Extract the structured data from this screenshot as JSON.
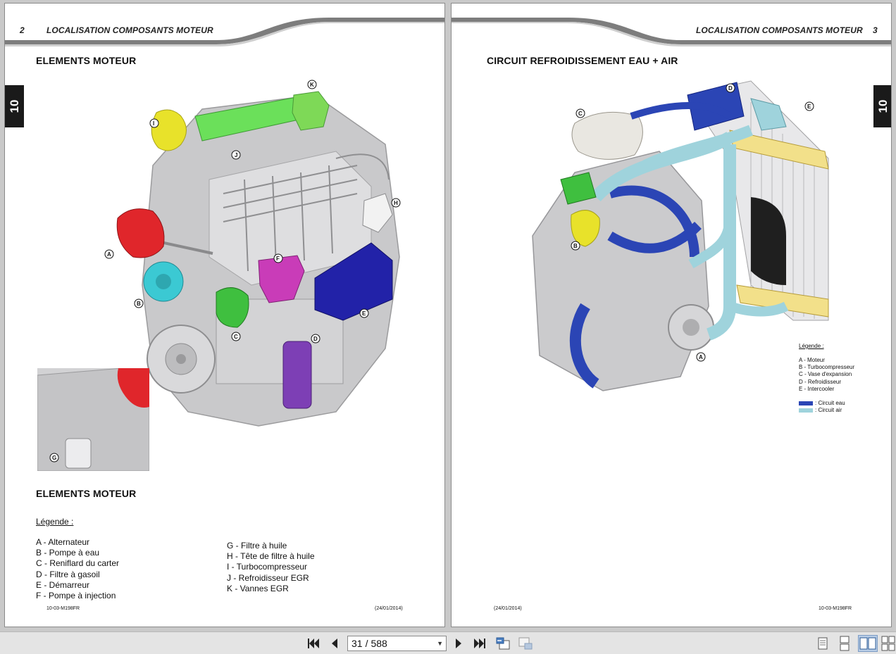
{
  "left_page": {
    "page_number": "2",
    "header_title": "LOCALISATION COMPOSANTS MOTEUR",
    "tab_label": "10",
    "section_title": "ELEMENTS MOTEUR",
    "section_title_2": "ELEMENTS MOTEUR",
    "figure_callouts": [
      "A",
      "B",
      "C",
      "D",
      "E",
      "F",
      "H",
      "I",
      "J",
      "K"
    ],
    "inset_callout": "G",
    "legend_title": "Légende :",
    "legend_col1": [
      "A - Alternateur",
      "B - Pompe à eau",
      "C - Reniflard du carter",
      "D - Filtre à gasoil",
      "E - Démarreur",
      "F - Pompe à injection"
    ],
    "legend_col2": [
      "G - Filtre à huile",
      "H - Tête de filtre à huile",
      "I - Turbocompresseur",
      "J - Refroidisseur EGR",
      "K - Vannes EGR"
    ],
    "footer_ref": "10-03-M198FR",
    "footer_date": "(24/01/2014)"
  },
  "right_page": {
    "page_number": "3",
    "header_title": "LOCALISATION COMPOSANTS MOTEUR",
    "tab_label": "10",
    "section_title": "CIRCUIT REFROIDISSEMENT EAU + AIR",
    "figure_callouts": [
      "A",
      "B",
      "C",
      "D",
      "E"
    ],
    "legend_title": "Légende :",
    "legend_items": [
      "A - Moteur",
      "B - Turbocompresseur",
      "C - Vase d'expansion",
      "D - Refroidisseur",
      "E - Intercooler"
    ],
    "circuits": [
      {
        "label": ": Circuit eau",
        "color": "#2b45b5"
      },
      {
        "label": ": Circuit air",
        "color": "#9fd3dc"
      }
    ],
    "footer_date": "(24/01/2014)",
    "footer_ref": "10-03-M198FR"
  },
  "toolbar": {
    "current_page": "31",
    "separator": "/",
    "total_pages": "588",
    "icons": [
      "first-page-icon",
      "previous-page-icon",
      "next-page-icon",
      "last-page-icon",
      "back-view-icon",
      "forward-view-icon",
      "single-page-view-icon",
      "continuous-view-icon",
      "facing-view-icon",
      "continuous-facing-view-icon"
    ]
  },
  "colors": {
    "alternator_red": "#e0262b",
    "water_pump_cyan": "#3bc9d3",
    "breather_green": "#3fbf3f",
    "fuel_filter_purple": "#7d3fb5",
    "starter_blue": "#2222a8",
    "injection_pump_magenta": "#c93cb8",
    "turbo_yellow": "#e8e22a",
    "egr_cooler_green": "#6be05a",
    "egr_valve_green": "#7ed957",
    "water_circuit": "#2b45b5",
    "air_circuit": "#9fd3dc",
    "intercooler_yellow": "#f2e08a"
  }
}
